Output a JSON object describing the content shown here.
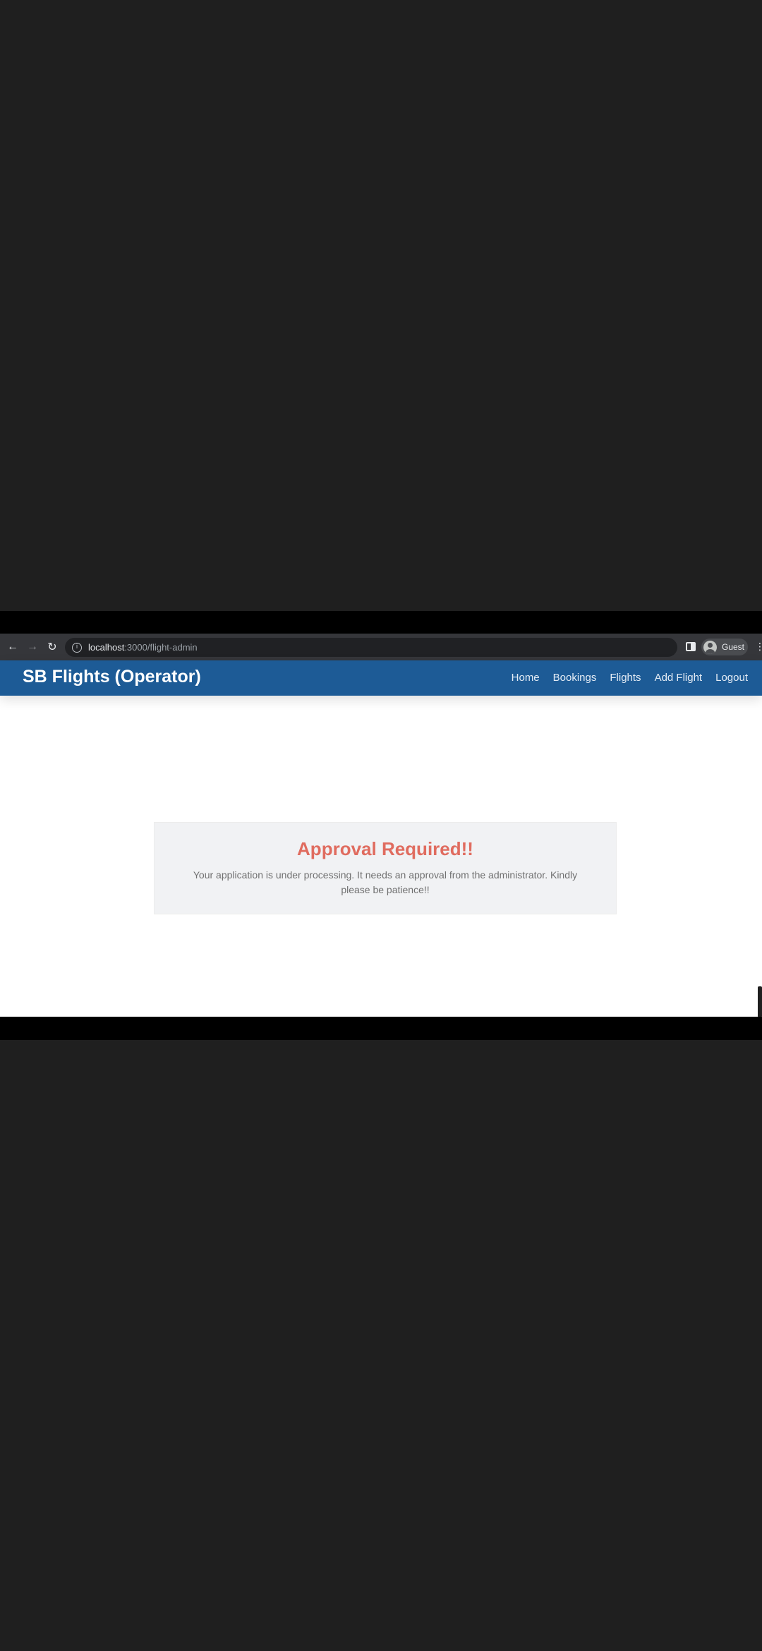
{
  "browser": {
    "url_host": "localhost",
    "url_path": ":3000/flight-admin",
    "profile_label": "Guest"
  },
  "navbar": {
    "brand": "SB Flights (Operator)",
    "links": [
      "Home",
      "Bookings",
      "Flights",
      "Add Flight",
      "Logout"
    ]
  },
  "notice": {
    "title": "Approval Required!!",
    "message": "Your application is under processing. It needs an approval from the administrator. Kindly please be patience!!"
  },
  "colors": {
    "navbar": "#1d5b96",
    "title": "#e06c5f",
    "card": "#f1f2f4"
  },
  "icons": {
    "back": "back-arrow-icon",
    "forward": "forward-arrow-icon",
    "reload": "reload-icon",
    "info": "info-icon",
    "side_panel": "side-panel-icon",
    "profile": "profile-avatar-icon",
    "menu": "kebab-menu-icon"
  }
}
